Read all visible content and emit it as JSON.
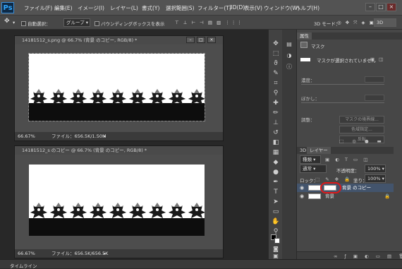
{
  "app": {
    "logo": "Ps"
  },
  "menu": [
    "ファイル(F)",
    "編集(E)",
    "イメージ(I)",
    "レイヤー(L)",
    "書式(Y)",
    "選択範囲(S)",
    "フィルター(T)",
    "3D(D)",
    "表示(V)",
    "ウィンドウ(W)",
    "ヘルプ(H)"
  ],
  "window_controls": {
    "minimize": "–",
    "maximize": "□",
    "close": "×"
  },
  "options": {
    "auto_select": "自動選択：",
    "group": "グループ",
    "bounding_box": "バウンディングボックスを表示",
    "mode_3d": "3D モード：",
    "workspace": "3D"
  },
  "doc1": {
    "title": "14181512_s.png @ 66.7% (背景 のコピー, RGB/8) *",
    "zoom": "66.67%",
    "file": "ファイル：656.5K/1.50M"
  },
  "doc2": {
    "title": "14181512_s のコピー @ 66.7% (背景 のコピー, RGB/8) *",
    "zoom": "66.67%",
    "file": "ファイル：656.5K/656.5K"
  },
  "properties": {
    "tab": "属性",
    "title": "マスク",
    "message": "マスクが選択されていません",
    "density": "濃度：",
    "feather": "ぼかし：",
    "adjust": "調整：",
    "mask_edge": "マスクの境界線...",
    "color_range": "色域指定...",
    "invert": "反転"
  },
  "layers": {
    "tab_3d": "3D",
    "tab_layers": "レイヤー",
    "kind": "種類",
    "normal": "通常",
    "opacity_label": "不透明度：",
    "opacity": "100%",
    "lock_label": "ロック：",
    "fill_label": "塗り：",
    "fill": "100%",
    "items": [
      {
        "name": "背景 のコピー"
      },
      {
        "name": "背景"
      }
    ]
  },
  "statusbar": {
    "timeline": "タイムライン"
  },
  "colors": {
    "selection_highlight": "#e01818",
    "layer_selected": "#43546c"
  }
}
